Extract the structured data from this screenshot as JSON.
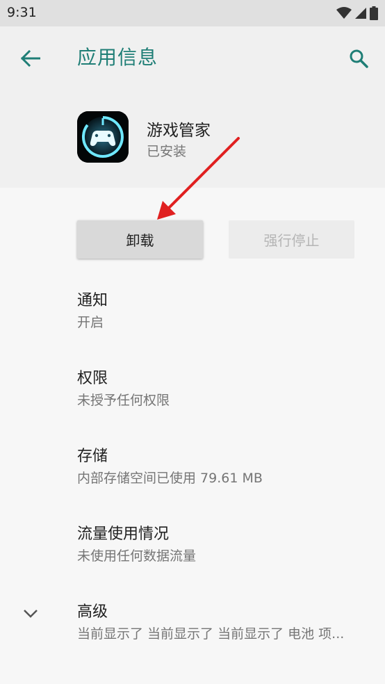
{
  "status_bar": {
    "time": "9:31",
    "icons": [
      "wifi-icon",
      "signal-icon",
      "battery-icon"
    ]
  },
  "header": {
    "title": "应用信息",
    "back_icon": "arrow-left-icon",
    "search_icon": "search-icon"
  },
  "app": {
    "name": "游戏管家",
    "status": "已安装",
    "icon": "gamepad-icon"
  },
  "buttons": {
    "uninstall": "卸载",
    "force_stop": "强行停止"
  },
  "settings": [
    {
      "title": "通知",
      "subtitle": "开启"
    },
    {
      "title": "权限",
      "subtitle": "未授予任何权限"
    },
    {
      "title": "存储",
      "subtitle": "内部存储空间已使用 79.61 MB"
    },
    {
      "title": "流量使用情况",
      "subtitle": "未使用任何数据流量"
    },
    {
      "title": "高级",
      "subtitle": "当前显示了 当前显示了 当前显示了 电池 项..."
    }
  ],
  "colors": {
    "accent": "#1f7e76",
    "annotation_arrow": "#e02020"
  }
}
